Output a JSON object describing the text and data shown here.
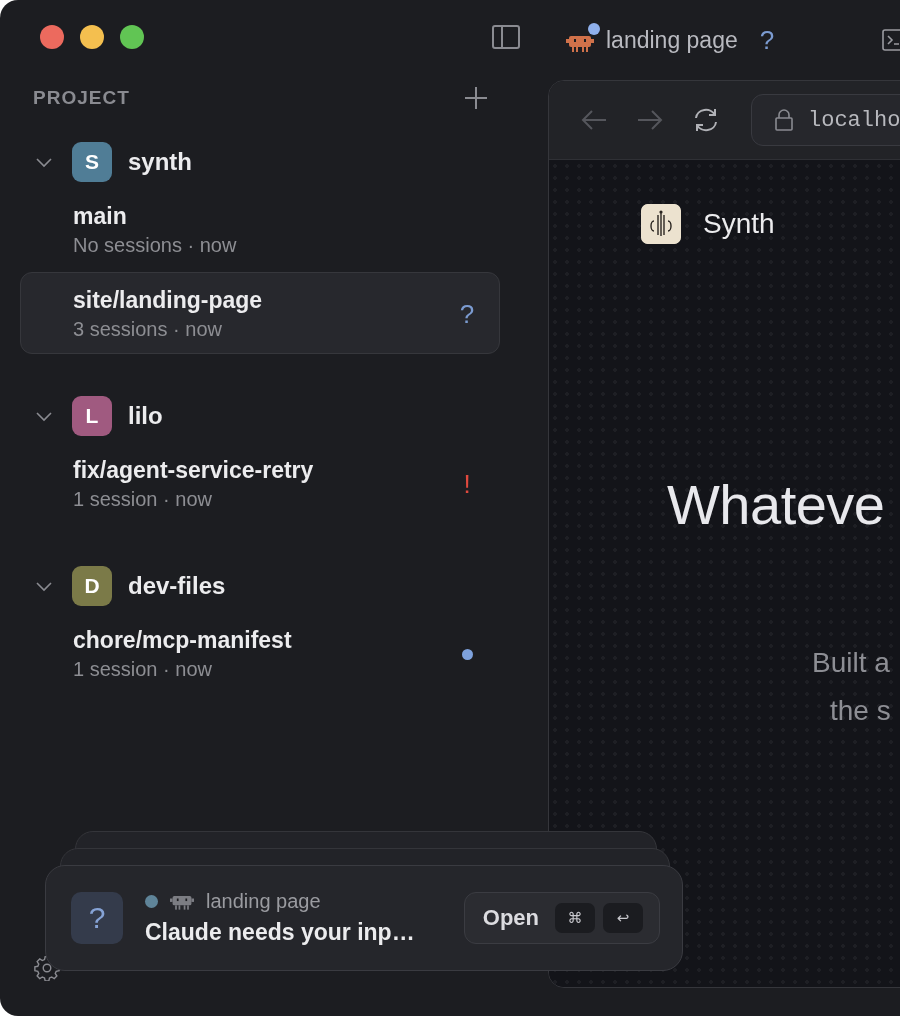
{
  "window": {
    "controls": [
      {
        "color": "#ec6a5e"
      },
      {
        "color": "#f4bf4f"
      },
      {
        "color": "#61c554"
      }
    ]
  },
  "sidebar": {
    "heading": "PROJECT",
    "groups": [
      {
        "initial": "S",
        "name": "synth",
        "color": "#507d96",
        "expanded": true,
        "branches": [
          {
            "name": "main",
            "meta": "No sessions · now",
            "selected": false
          },
          {
            "name": "site/landing-page",
            "meta": "3 sessions · now",
            "selected": true,
            "status": {
              "kind": "question",
              "glyph": "?"
            }
          }
        ]
      },
      {
        "initial": "L",
        "name": "lilo",
        "color": "#a05a80",
        "expanded": true,
        "branches": [
          {
            "name": "fix/agent-service-retry",
            "meta": "1 session · now",
            "selected": false,
            "status": {
              "kind": "error",
              "glyph": "!"
            }
          }
        ]
      },
      {
        "initial": "D",
        "name": "dev-files",
        "color": "#7b7a48",
        "expanded": true,
        "branches": [
          {
            "name": "chore/mcp-manifest",
            "meta": "1 session · now",
            "selected": false,
            "status": {
              "kind": "dot"
            }
          }
        ]
      }
    ]
  },
  "tab": {
    "title": "landing page",
    "unread": true,
    "badge": "?"
  },
  "browser": {
    "url": "localho",
    "page": {
      "brand": "Synth",
      "heading": "Whateve",
      "subtitle_lines": [
        "Built a",
        "the s"
      ]
    }
  },
  "toast": {
    "icon_glyph": "?",
    "color": "#5f8499",
    "project": "landing page",
    "message": "Claude needs your inp…",
    "action": {
      "label": "Open",
      "keys": [
        "⌘",
        "↩"
      ]
    }
  }
}
